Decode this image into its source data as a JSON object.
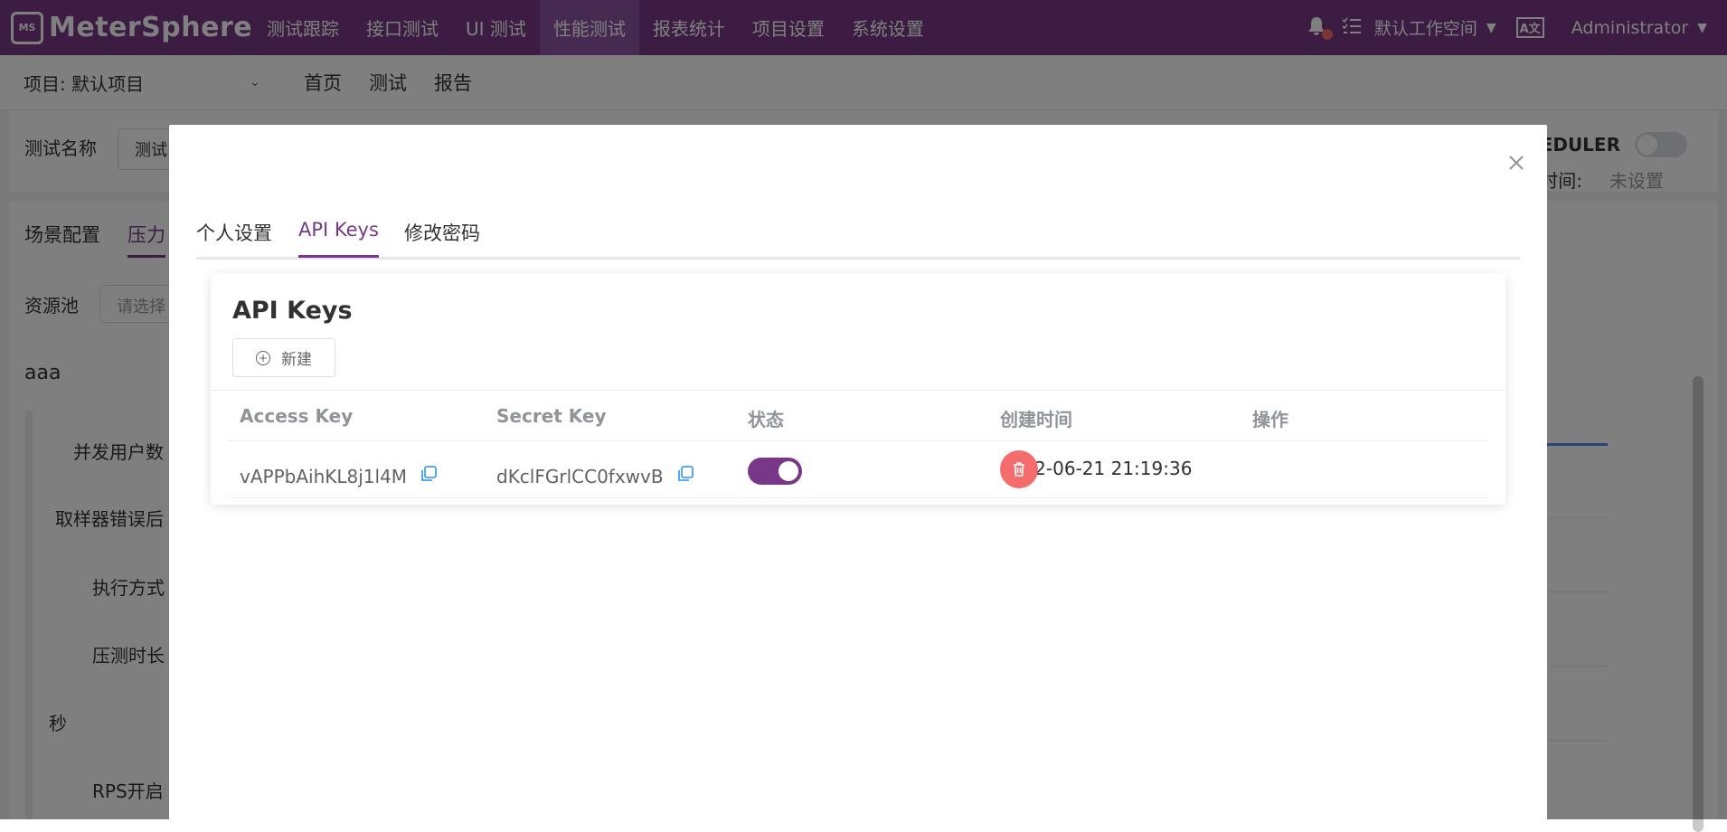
{
  "header": {
    "logo_text": "MeterSphere",
    "logo_mark": "MS",
    "nav": [
      "测试跟踪",
      "接口测试",
      "UI 测试",
      "性能测试",
      "报表统计",
      "项目设置",
      "系统设置"
    ],
    "active_nav_index": 3,
    "workspace": "默认工作空间",
    "user": "Administrator",
    "brand_color": "#783887",
    "notification_dot_color": "#f56c6c"
  },
  "subheader": {
    "project": "项目: 默认项目",
    "nav": [
      "首页",
      "测试",
      "报告"
    ]
  },
  "background": {
    "test_name_label": "测试名称",
    "test_name_value": "测试",
    "scheduler_label": "HEDULER",
    "time_label": "时间:",
    "time_value": "未设置",
    "tabs": [
      "场景配置",
      "压力"
    ],
    "resource_pool_label": "资源池",
    "resource_pool_placeholder": "请选择",
    "scenario_name": "aaa",
    "labels": {
      "concurrency": "并发用户数",
      "sampler_error": "取样器错误后",
      "exec_mode": "执行方式",
      "duration": "压测时长",
      "seconds": "秒",
      "rps": "RPS开启"
    }
  },
  "modal": {
    "tabs": [
      "个人设置",
      "API Keys",
      "修改密码"
    ],
    "active_tab_index": 1,
    "panel_title": "API Keys",
    "new_button": "新建",
    "columns": [
      "Access Key",
      "Secret Key",
      "状态",
      "创建时间",
      "操作"
    ],
    "rows": [
      {
        "access_key": "vAPPbAihKL8j1l4M",
        "secret_key": "dKclFGrlCC0fxwvB",
        "enabled": true,
        "created": "2022-06-21 21:19:36"
      }
    ],
    "delete_color": "#f56c6c"
  }
}
